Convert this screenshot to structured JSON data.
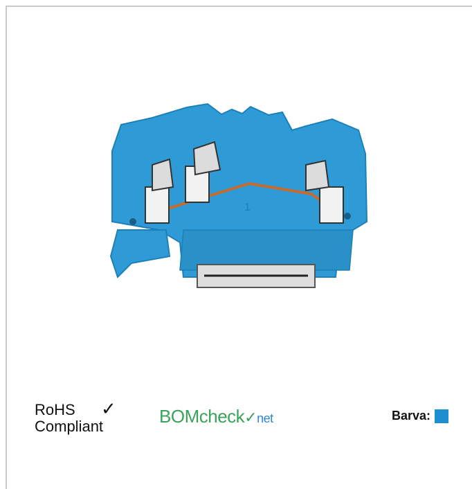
{
  "product": {
    "image_label": "Product image",
    "colors": {
      "housing": "#2e9bd6",
      "housing_dark": "#1f7fb8",
      "clamp": "#f2f2f2",
      "rail": "#dedede"
    },
    "marking": "1"
  },
  "badges": {
    "rohs_line1": "RoHS",
    "rohs_line2": "Compliant",
    "rohs_check_icon": "checkmark-icon",
    "bom_part1": "BOM",
    "bom_part2": "check",
    "bom_part3": "net",
    "bom_tick": "✓"
  },
  "color_field": {
    "label": "Barva:",
    "value_color": "#1d8fd1"
  }
}
